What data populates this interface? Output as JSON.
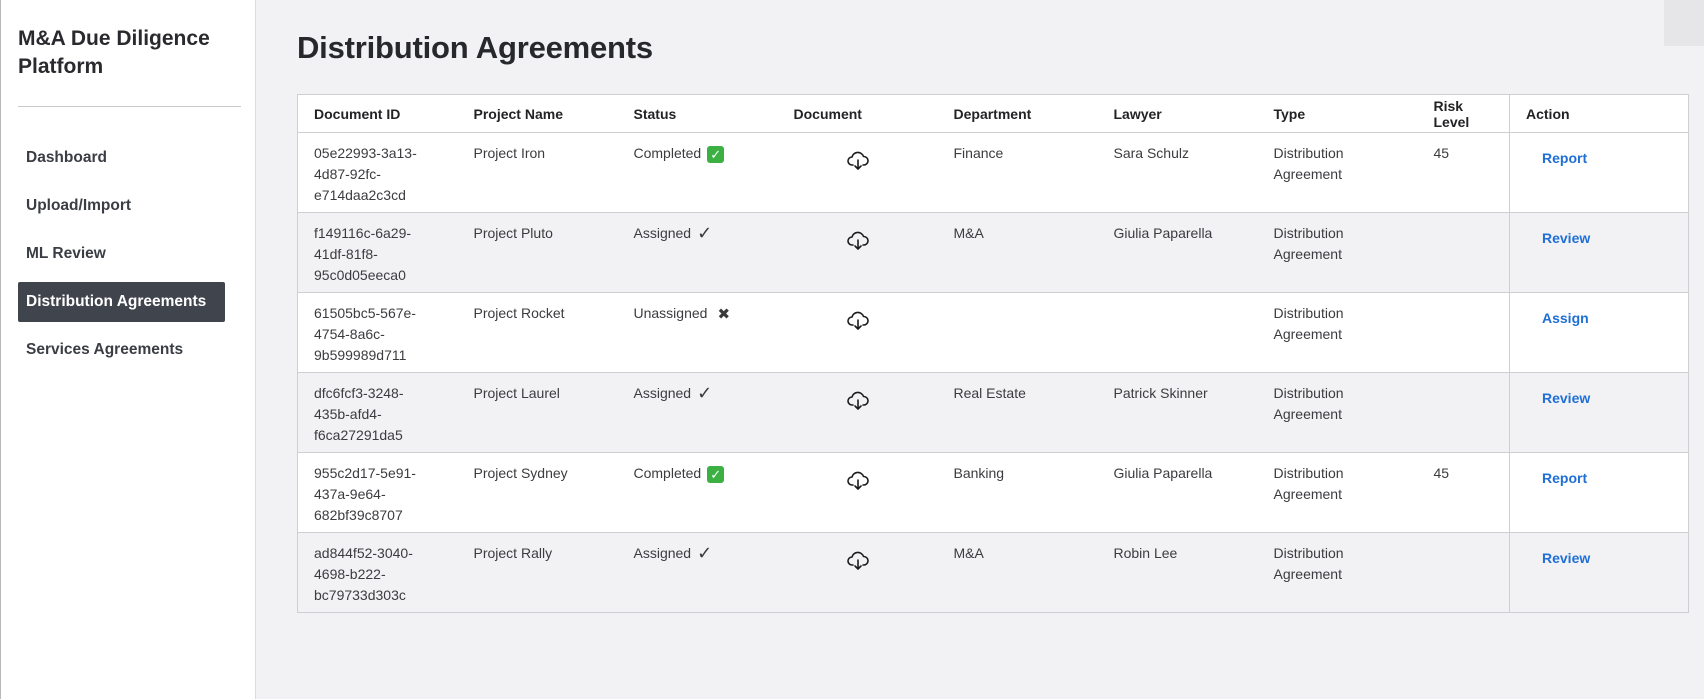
{
  "sidebar": {
    "brand": "M&A Due Diligence Platform",
    "items": [
      {
        "label": "Dashboard",
        "active": false
      },
      {
        "label": "Upload/Import",
        "active": false
      },
      {
        "label": "ML Review",
        "active": false
      },
      {
        "label": "Distribution Agreements",
        "active": true
      },
      {
        "label": "Services Agreements",
        "active": false
      }
    ]
  },
  "main": {
    "title": "Distribution Agreements",
    "table": {
      "headers": [
        "Document ID",
        "Project Name",
        "Status",
        "Document",
        "Department",
        "Lawyer",
        "Type",
        "Risk Level",
        "Action"
      ],
      "rows": [
        {
          "id_lines": [
            "05e22993-3a13-",
            "4d87-92fc-",
            "e714daa2c3cd"
          ],
          "project": "Project Iron",
          "status": "Completed",
          "status_icon": "check-box-icon",
          "document_icon": "cloud-download-icon",
          "department": "Finance",
          "lawyer": "Sara Schulz",
          "type_lines": [
            "Distribution",
            "Agreement"
          ],
          "risk": "45",
          "action": "Report"
        },
        {
          "id_lines": [
            "f149116c-6a29-",
            "41df-81f8-",
            "95c0d05eeca0"
          ],
          "project": "Project Pluto",
          "status": "Assigned",
          "status_icon": "check-mark-icon",
          "document_icon": "cloud-download-icon",
          "department": "M&A",
          "lawyer": "Giulia Paparella",
          "type_lines": [
            "Distribution",
            "Agreement"
          ],
          "risk": "",
          "action": "Review"
        },
        {
          "id_lines": [
            "61505bc5-567e-",
            "4754-8a6c-",
            "9b599989d711"
          ],
          "project": "Project Rocket",
          "status": "Unassigned",
          "status_icon": "cross-icon",
          "document_icon": "cloud-download-icon",
          "department": "",
          "lawyer": "",
          "type_lines": [
            "Distribution",
            "Agreement"
          ],
          "risk": "",
          "action": "Assign"
        },
        {
          "id_lines": [
            "dfc6fcf3-3248-",
            "435b-afd4-",
            "f6ca27291da5"
          ],
          "project": "Project Laurel",
          "status": "Assigned",
          "status_icon": "check-mark-icon",
          "document_icon": "cloud-download-icon",
          "department": "Real Estate",
          "lawyer": "Patrick Skinner",
          "type_lines": [
            "Distribution",
            "Agreement"
          ],
          "risk": "",
          "action": "Review"
        },
        {
          "id_lines": [
            "955c2d17-5e91-",
            "437a-9e64-",
            "682bf39c8707"
          ],
          "project": "Project Sydney",
          "status": "Completed",
          "status_icon": "check-box-icon",
          "document_icon": "cloud-download-icon",
          "department": "Banking",
          "lawyer": "Giulia Paparella",
          "type_lines": [
            "Distribution",
            "Agreement"
          ],
          "risk": "45",
          "action": "Report"
        },
        {
          "id_lines": [
            "ad844f52-3040-",
            "4698-b222-",
            "bc79733d303c"
          ],
          "project": "Project Rally",
          "status": "Assigned",
          "status_icon": "check-mark-icon",
          "document_icon": "cloud-download-icon",
          "department": "M&A",
          "lawyer": "Robin Lee",
          "type_lines": [
            "Distribution",
            "Agreement"
          ],
          "risk": "",
          "action": "Review"
        }
      ]
    }
  },
  "colors": {
    "accent_link": "#1f6fd6",
    "active_nav_bg": "#3f444d",
    "completed_green": "#3cb043",
    "page_bg": "#f2f2f4"
  }
}
